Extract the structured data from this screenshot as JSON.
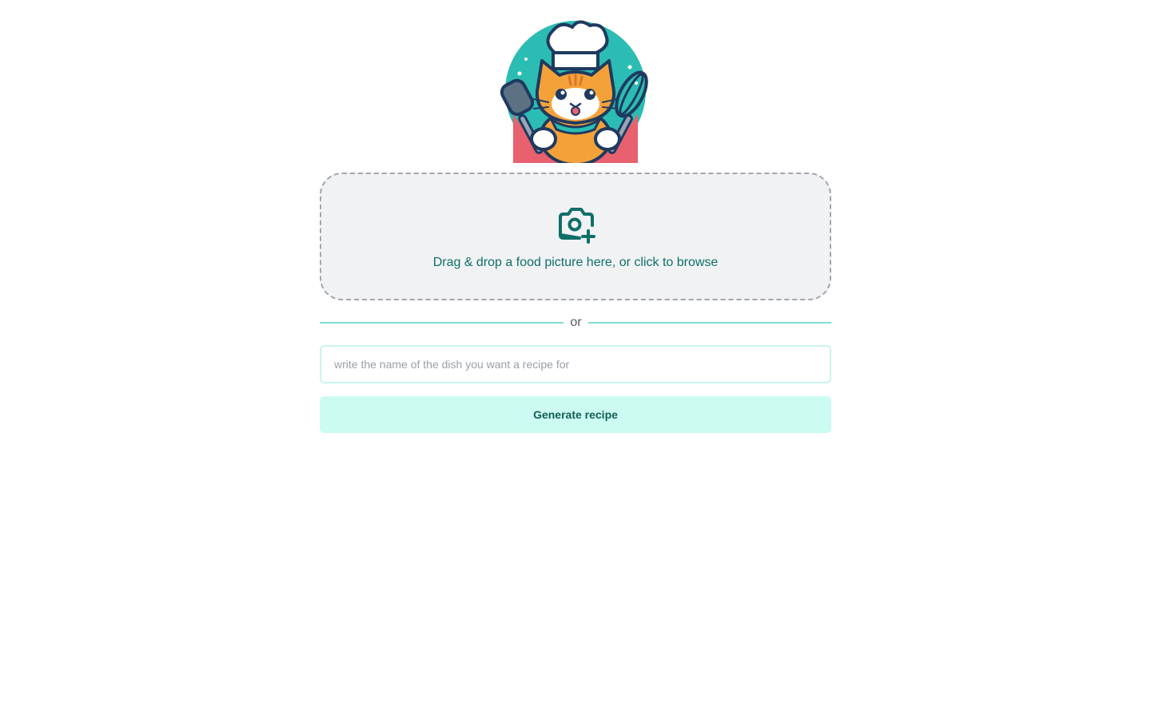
{
  "logo": {
    "icon": "chef-cat-logo-icon"
  },
  "upload": {
    "icon": "camera-plus-icon",
    "text": "Drag & drop a food picture here, or click to browse"
  },
  "divider": {
    "label": "or"
  },
  "search": {
    "value": "",
    "placeholder": "write the name of the dish you want a recipe for"
  },
  "generate": {
    "label": "Generate recipe"
  },
  "colors": {
    "accent_text": "#0e6f68",
    "divider_line": "#7fdccf",
    "button_bg": "#ccfbf1",
    "button_text": "#115e59",
    "dropzone_bg": "#f1f2f4"
  }
}
